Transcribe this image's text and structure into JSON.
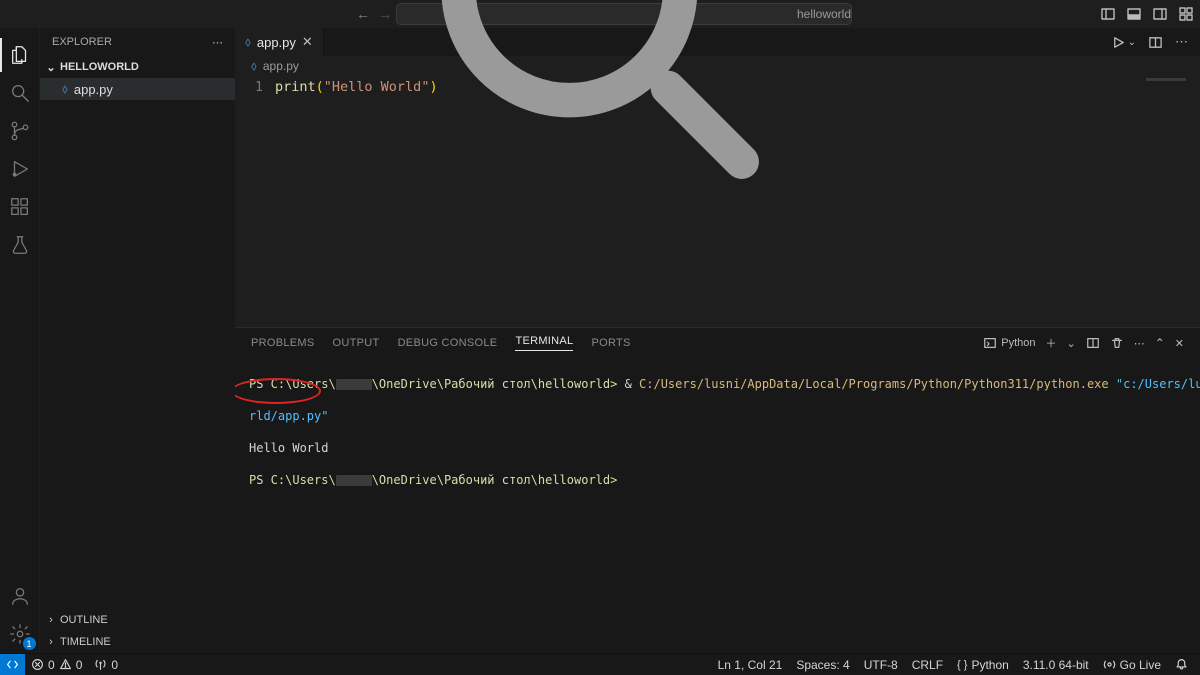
{
  "title": {
    "search": "helloworld"
  },
  "activity": {
    "settings_badge": "1"
  },
  "sidebar": {
    "title": "EXPLORER",
    "folder": "HELLOWORLD",
    "files": [
      {
        "name": "app.py"
      }
    ],
    "outline": "OUTLINE",
    "timeline": "TIMELINE"
  },
  "tabs": {
    "active": "app.py"
  },
  "breadcrumb": {
    "file": "app.py"
  },
  "code": {
    "lines": [
      {
        "n": "1",
        "fn": "print",
        "lp": "(",
        "str": "\"Hello World\"",
        "rp": ")"
      }
    ]
  },
  "panel": {
    "tabs": {
      "problems": "PROBLEMS",
      "output": "OUTPUT",
      "debug": "DEBUG CONSOLE",
      "terminal": "TERMINAL",
      "ports": "PORTS"
    },
    "right_label": "Python",
    "term": {
      "l1_prefix": "PS C:\\Users\\",
      "l1_path": "\\OneDrive\\Рабочий стол\\helloworld>",
      "l1_amp": " & ",
      "l1_exe": "C:/Users/lusni/AppData/Local/Programs/Python/Python311/python.exe",
      "l1_arg_a": " \"c:/Users/lusni/OneDrive/Рабочий стол/hellowo",
      "l2_arg_b": "rld/app.py\"",
      "l3_out": "Hello World",
      "l4_prefix": "PS C:\\Users\\",
      "l4_path": "\\OneDrive\\Рабочий стол\\helloworld>"
    }
  },
  "status": {
    "errors": "0",
    "warnings": "0",
    "ports": "0",
    "ln_col": "Ln 1, Col 21",
    "spaces": "Spaces: 4",
    "encoding": "UTF-8",
    "eol": "CRLF",
    "lang": "Python",
    "interpreter": "3.11.0 64-bit",
    "golive": "Go Live"
  }
}
